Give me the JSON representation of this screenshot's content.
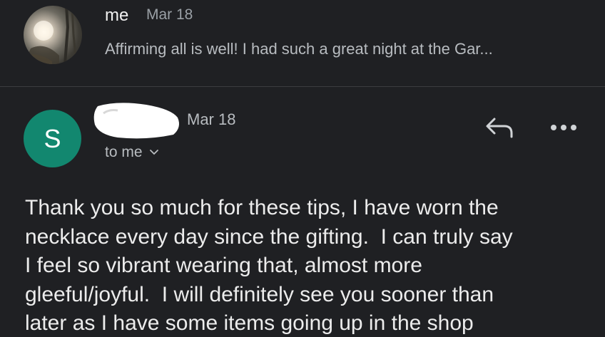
{
  "previous_message": {
    "sender": "me",
    "date": "Mar 18",
    "snippet": "Affirming all is well! I had such a great night at the Gar..."
  },
  "message": {
    "avatar_letter": "S",
    "avatar_color": "#12876f",
    "date": "Mar 18",
    "recipient_label": "to me",
    "body_lines": [
      "Thank you so much for these tips, I have worn the",
      "necklace every day since the gifting.  I can truly say",
      "I feel so vibrant wearing that, almost more",
      "gleeful/joyful.  I will definitely see you sooner than",
      "later as I have some items going up in the shop"
    ]
  },
  "actions": {
    "reply_icon": "reply-icon",
    "more_icon": "more-options-icon"
  }
}
